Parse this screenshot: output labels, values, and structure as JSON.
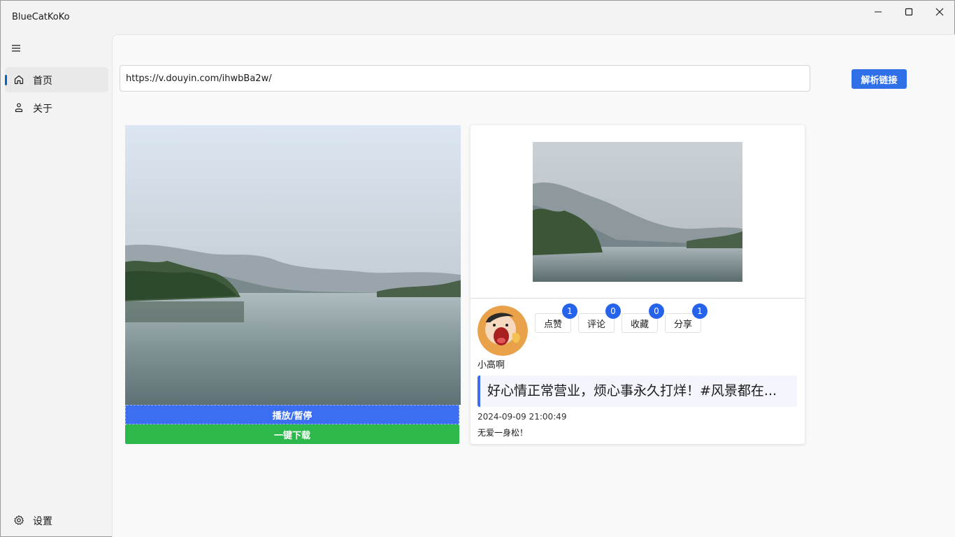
{
  "window": {
    "title": "BlueCatKoKo",
    "controls": {
      "minimize": "minimize",
      "maximize": "maximize",
      "close": "close"
    }
  },
  "sidebar": {
    "menu_icon": "hamburger-icon",
    "items": [
      {
        "label": "首页",
        "icon": "home-icon",
        "active": true
      },
      {
        "label": "关于",
        "icon": "person-icon",
        "active": false
      }
    ],
    "footer": {
      "label": "设置",
      "icon": "gear-icon"
    }
  },
  "toolbar": {
    "url_value": "https://v.douyin.com/ihwbBa2w/",
    "parse_label": "解析链接"
  },
  "player": {
    "play_label": "播放/暂停",
    "download_label": "一键下载"
  },
  "card": {
    "stats": [
      {
        "label": "点赞",
        "count": "1"
      },
      {
        "label": "评论",
        "count": "0"
      },
      {
        "label": "收藏",
        "count": "0"
      },
      {
        "label": "分享",
        "count": "1"
      }
    ],
    "author": "小高啊",
    "description": "好心情正常营业，烦心事永久打烊！#风景都在...",
    "time": "2024-09-09 21:00:49",
    "signature": "无爱一身松！"
  },
  "colors": {
    "accent": "#2f6fe8",
    "play": "#3b6ef0",
    "download": "#2db84b",
    "badge": "#2563eb"
  }
}
